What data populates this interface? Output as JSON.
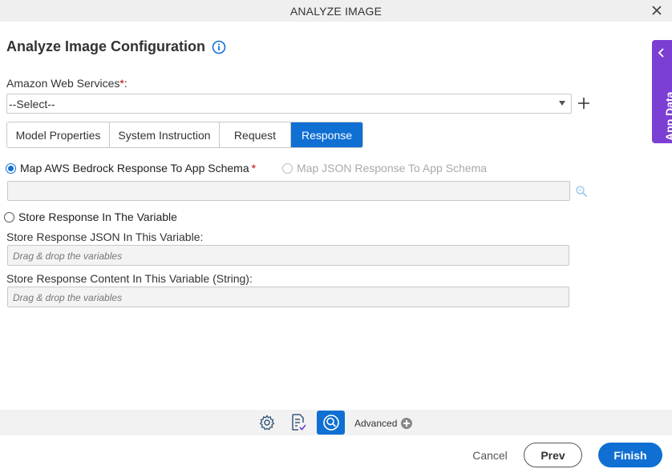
{
  "window": {
    "title": "ANALYZE IMAGE"
  },
  "page": {
    "heading": "Analyze Image Configuration"
  },
  "side_panel": {
    "label": "App Data"
  },
  "aws": {
    "label": "Amazon Web Services",
    "required_mark": "*",
    "colon": ":",
    "selected": "--Select--"
  },
  "tabs": [
    {
      "label": "Model Properties",
      "active": false
    },
    {
      "label": "System Instruction",
      "active": false
    },
    {
      "label": "Request",
      "active": false
    },
    {
      "label": "Response",
      "active": true
    }
  ],
  "response": {
    "map_bedrock_label": "Map AWS Bedrock Response To App Schema",
    "map_bedrock_required": "*",
    "map_json_label": "Map JSON Response To App Schema",
    "store_variable_label": "Store Response In The Variable",
    "json_var_label": "Store Response JSON In This Variable:",
    "json_var_placeholder": "Drag & drop the variables",
    "content_var_label": "Store Response Content In This Variable (String):",
    "content_var_placeholder": "Drag & drop the variables"
  },
  "toolbar": {
    "advanced_label": "Advanced"
  },
  "footer": {
    "cancel_label": "Cancel",
    "prev_label": "Prev",
    "finish_label": "Finish"
  },
  "colors": {
    "accent": "#0f6fd3",
    "side_panel": "#7b3fd3"
  }
}
